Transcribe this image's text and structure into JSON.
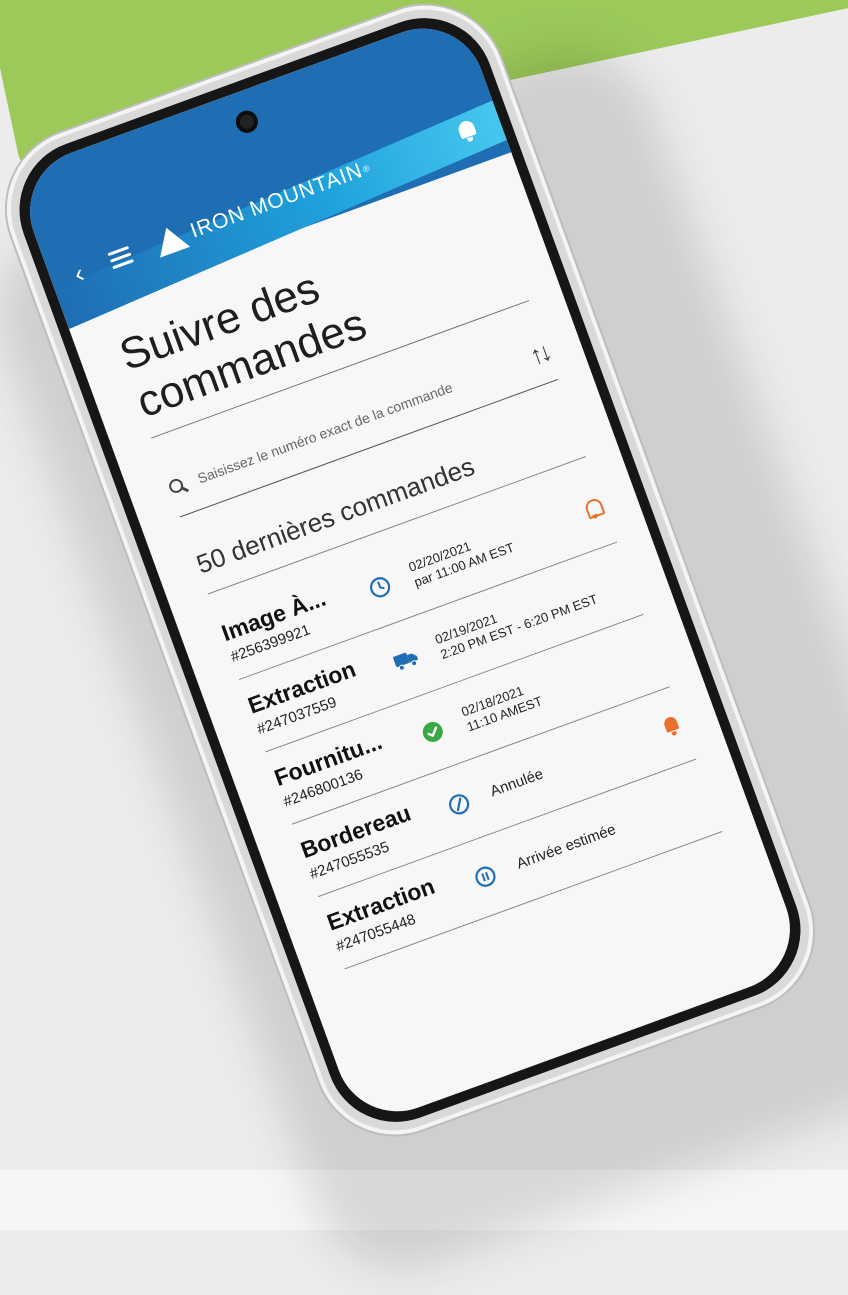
{
  "header": {
    "brand": "IRON MOUNTAIN",
    "brand_mark": "®",
    "colors": {
      "header_blue": "#1f6db3",
      "wave_cyan": "#46c7ef",
      "accent_green": "#9cc95a",
      "alert_orange": "#e8702a"
    }
  },
  "page": {
    "title": "Suivre des commandes"
  },
  "search": {
    "placeholder": "Saisissez le numéro exact de la commande",
    "value": ""
  },
  "orders_section": {
    "count_label": "50 dernières commandes"
  },
  "orders": [
    {
      "type": "Image À...",
      "number": "#256399921",
      "status_icon": "clock-icon",
      "status_line1": "02/20/2021",
      "status_line2": "par 11:00 AM EST",
      "alert": "bell-outline-icon"
    },
    {
      "type": "Extraction",
      "number": "#247037559",
      "status_icon": "truck-icon",
      "status_line1": "02/19/2021",
      "status_line2": "2:20 PM EST - 6:20 PM EST",
      "alert": "none"
    },
    {
      "type": "Fournitu...",
      "number": "#246800136",
      "status_icon": "check-circle-icon",
      "status_line1": "02/18/2021",
      "status_line2": "11:10 AMEST",
      "alert": "none"
    },
    {
      "type": "Bordereau",
      "number": "#247055535",
      "status_icon": "cancel-icon",
      "status_line1": "Annulée",
      "status_line2": "",
      "alert": "bell-filled-icon"
    },
    {
      "type": "Extraction",
      "number": "#247055448",
      "status_icon": "pause-icon",
      "status_line1": "Arrivée estimée",
      "status_line2": "",
      "alert": "none"
    }
  ]
}
